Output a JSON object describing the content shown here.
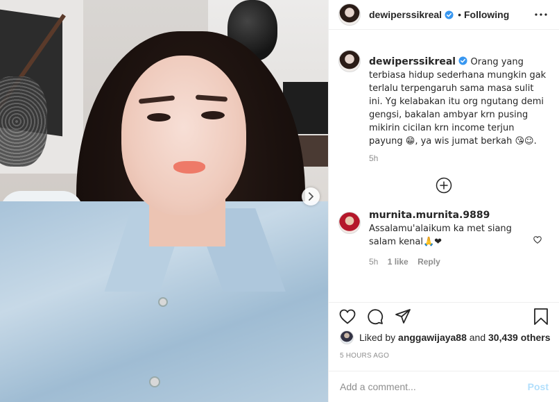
{
  "post": {
    "username": "dewiperssikreal",
    "follow_status": "Following",
    "separator": "•"
  },
  "caption": {
    "username": "dewiperssikreal",
    "text": "Orang yang terbiasa hidup sederhana mungkin gak terlalu terpengaruh sama masa sulit ini. Yg kelabakan itu org ngutang demi gengsi, bakalan ambyar krn pusing mikirin cicilan krn income terjun payung 😁, ya wis jumat berkah 😘☺.",
    "time": "5h"
  },
  "comment": {
    "username": "murnita.murnita.9889",
    "text": "Assalamu'alaikum ka met siang salam kenal🙏❤",
    "time": "5h",
    "likes": "1 like",
    "reply_label": "Reply"
  },
  "likes": {
    "prefix": "Liked by",
    "user": "anggawijaya88",
    "connector": "and",
    "others": "30,439 others"
  },
  "timestamp": "5 HOURS AGO",
  "add_comment": {
    "placeholder": "Add a comment...",
    "post_label": "Post"
  },
  "colors": {
    "verified": "#3897f0",
    "heart_red": "#ed4956",
    "post_disabled": "#b2dffc",
    "muted": "#8e8e8e"
  },
  "icons": [
    "verified-badge-icon",
    "more-options-icon",
    "next-arrow-icon",
    "load-more-icon",
    "heart-icon",
    "comment-icon",
    "share-icon",
    "bookmark-icon"
  ]
}
